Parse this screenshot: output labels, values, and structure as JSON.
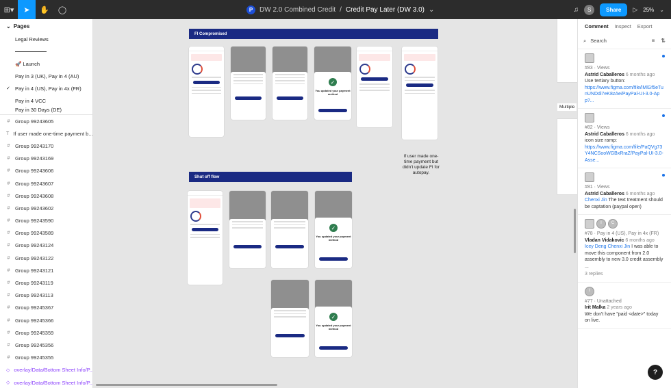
{
  "topbar": {
    "file_project": "DW 2.0 Combined Credit",
    "separator": "/",
    "file_name": "Credit Pay Later (DW 3.0)",
    "avatar_initial": "S",
    "share_label": "Share",
    "zoom": "25%"
  },
  "pages": {
    "header": "Pages",
    "items": [
      {
        "label": "Legal Reviews",
        "checked": false
      },
      {
        "label": "divider",
        "checked": false
      },
      {
        "label": "🚀 Launch",
        "checked": false
      },
      {
        "label": "Pay in 3 (UK), Pay in 4 (AU)",
        "checked": false
      },
      {
        "label": "Pay in 4 (US), Pay in 4x (FR)",
        "checked": true
      },
      {
        "label": "Pay in 4 VCC",
        "checked": false
      },
      {
        "label": "Pay in 30 Days (DE)",
        "checked": false
      }
    ]
  },
  "layers": [
    {
      "label": "Group 99243605",
      "icon": "#",
      "purple": false
    },
    {
      "label": "If user made one-time payment b...",
      "icon": "T",
      "purple": false
    },
    {
      "label": "Group 99243170",
      "icon": "#",
      "purple": false
    },
    {
      "label": "Group 99243169",
      "icon": "#",
      "purple": false
    },
    {
      "label": "Group 99243606",
      "icon": "#",
      "purple": false
    },
    {
      "label": "Group 99243607",
      "icon": "#",
      "purple": false
    },
    {
      "label": "Group 99243608",
      "icon": "#",
      "purple": false
    },
    {
      "label": "Group 99243602",
      "icon": "#",
      "purple": false
    },
    {
      "label": "Group 99243590",
      "icon": "#",
      "purple": false
    },
    {
      "label": "Group 99243589",
      "icon": "#",
      "purple": false
    },
    {
      "label": "Group 99243124",
      "icon": "#",
      "purple": false
    },
    {
      "label": "Group 99243122",
      "icon": "#",
      "purple": false
    },
    {
      "label": "Group 99243121",
      "icon": "#",
      "purple": false
    },
    {
      "label": "Group 99243119",
      "icon": "#",
      "purple": false
    },
    {
      "label": "Group 99243113",
      "icon": "#",
      "purple": false
    },
    {
      "label": "Group 99245367",
      "icon": "#",
      "purple": false
    },
    {
      "label": "Group 99245366",
      "icon": "#",
      "purple": false
    },
    {
      "label": "Group 99245359",
      "icon": "#",
      "purple": false
    },
    {
      "label": "Group 99245356",
      "icon": "#",
      "purple": false
    },
    {
      "label": "Group 99245355",
      "icon": "#",
      "purple": false
    },
    {
      "label": "overlay/Data/Bottom Sheet Info/P...",
      "icon": "◇",
      "purple": true
    },
    {
      "label": "overlay/Data/Bottom Sheet Info/P...",
      "icon": "◇",
      "purple": true
    }
  ],
  "canvas": {
    "section1_title": "FI Compromised",
    "section2_title": "Shut off flow",
    "note": "If user made one-time payment but didn't update FI for autopay.",
    "success_title": "You updated your payment method",
    "multiple_label": "Multiple"
  },
  "right_panel": {
    "tabs": [
      "Comment",
      "Inspect",
      "Export"
    ],
    "search_placeholder": "Search",
    "comments": [
      {
        "id": "#83",
        "meta": "Views",
        "author": "Astrid Caballeros",
        "time": "6 months ago",
        "body": "Use tertiary button:",
        "link": "https://www.figma.com/file/lMlGf5eTunUNDdi7eK8zAe/PayPal-UI-3.0-App?...",
        "mention": "",
        "replies": "",
        "unread": true
      },
      {
        "id": "#82",
        "meta": "Views",
        "author": "Astrid Caballeros",
        "time": "6 months ago",
        "body": "icon size ramp:",
        "link": "https://www.figma.com/file/PaQVg73Y4NCSooWGBxRraZ/PayPal-UI-3.0-Asse...",
        "mention": "",
        "replies": "",
        "unread": true
      },
      {
        "id": "#81",
        "meta": "Views",
        "author": "Astrid Caballeros",
        "time": "6 months ago",
        "body": "The text treatment should be captation (paypal open)",
        "link": "",
        "mention": "Chenxi Jin",
        "replies": "",
        "unread": true
      },
      {
        "id": "#78",
        "meta": "Pay in 4 (US), Pay in 4x (FR)",
        "author": "Vladan Vidakovic",
        "time": "6 months ago",
        "body": "I was able to move this component from 2.0 assembly to new 3.0 credit assembly ...",
        "link": "",
        "mention": "Icey Deng Chenxi Jin",
        "replies": "3 replies",
        "unread": false
      },
      {
        "id": "#77",
        "meta": "Unattached",
        "author": "Irit Malka",
        "time": "2 years ago",
        "body": "We don't have \"paid <date>\" today on live.",
        "link": "",
        "mention": "",
        "replies": "",
        "unread": false
      }
    ]
  },
  "help_label": "?"
}
